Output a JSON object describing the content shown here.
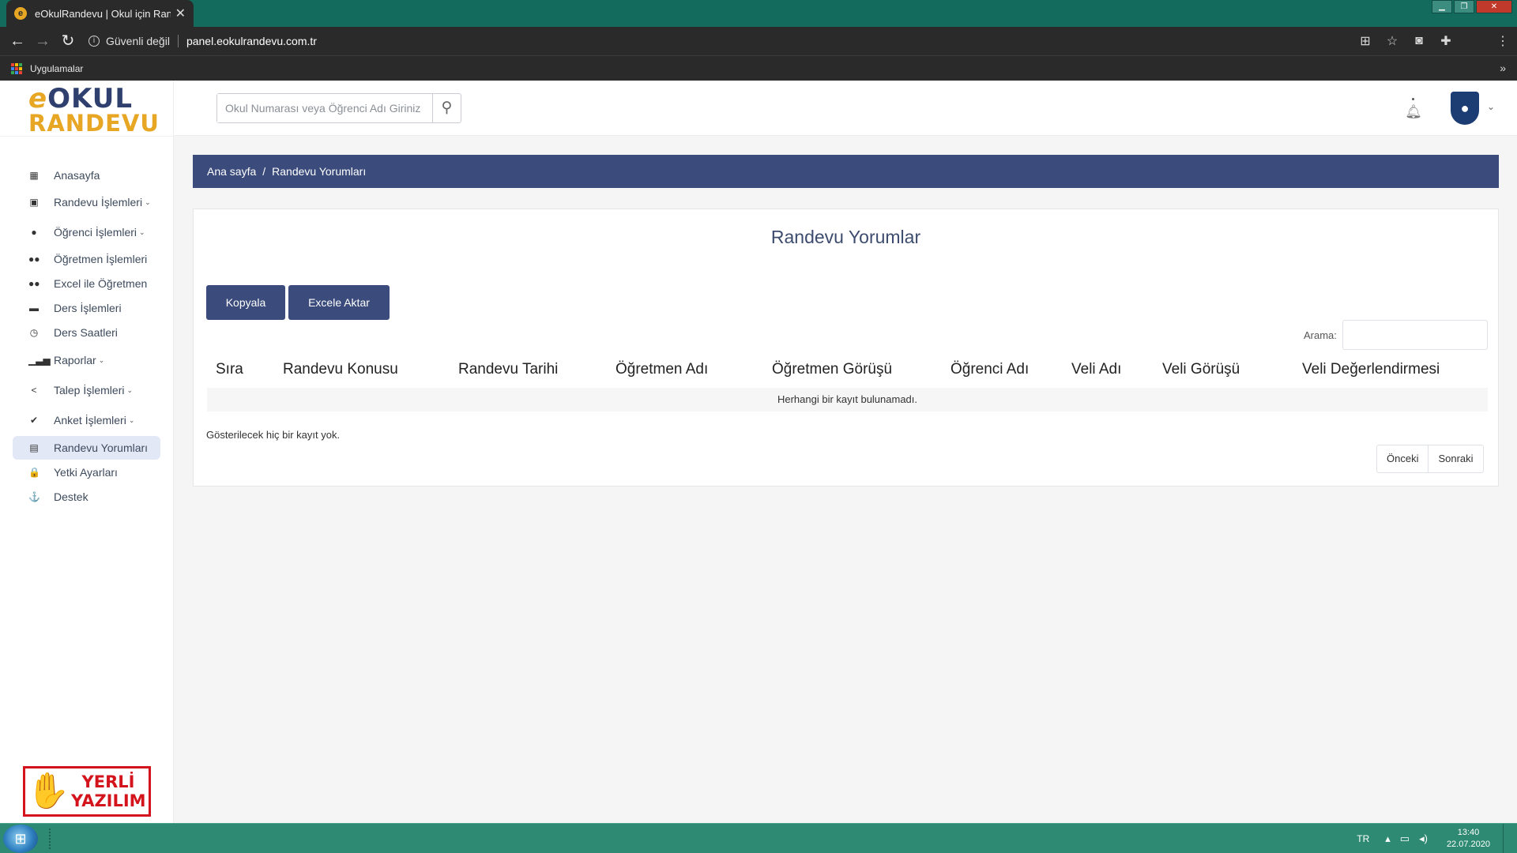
{
  "browser": {
    "tab_title": "eOkulRandevu | Okul için Randev",
    "tab_favicon": "e",
    "security_label": "Güvenli değil",
    "url": "panel.eokulrandevu.com.tr",
    "bookmarks_apps_label": "Uygulamalar",
    "bookmarks_more": "»"
  },
  "logo": {
    "line1_e": "e",
    "line1_rest": "OKUL",
    "line2": "RANDEVU"
  },
  "header": {
    "search_placeholder": "Okul Numarası veya Öğrenci Adı Giriniz"
  },
  "sidebar": {
    "items": [
      {
        "label": "Anasayfa",
        "icon": "dashboard-icon",
        "glyph": "▦",
        "caret": ""
      },
      {
        "label": "Randevu İşlemleri",
        "icon": "calendar-icon",
        "glyph": "▣",
        "caret": "⌄"
      },
      {
        "label": "Öğrenci İşlemleri",
        "icon": "user-icon",
        "glyph": "●",
        "caret": "⌄"
      },
      {
        "label": "Öğretmen İşlemleri",
        "icon": "users-icon",
        "glyph": "●●",
        "caret": ""
      },
      {
        "label": "Excel ile Öğretmen",
        "icon": "users-icon",
        "glyph": "●●",
        "caret": ""
      },
      {
        "label": "Ders İşlemleri",
        "icon": "folder-icon",
        "glyph": "▬",
        "caret": ""
      },
      {
        "label": "Ders Saatleri",
        "icon": "clock-icon",
        "glyph": "◷",
        "caret": ""
      },
      {
        "label": "Raporlar",
        "icon": "bar-chart-icon",
        "glyph": "▁▃▅",
        "caret": "⌄"
      },
      {
        "label": "Talep İşlemleri",
        "icon": "share-icon",
        "glyph": "<",
        "caret": "⌄"
      },
      {
        "label": "Anket İşlemleri",
        "icon": "check-circle-icon",
        "glyph": "✔",
        "caret": "⌄"
      },
      {
        "label": "Randevu Yorumları",
        "icon": "comment-icon",
        "glyph": "▤",
        "caret": ""
      },
      {
        "label": "Yetki Ayarları",
        "icon": "lock-icon",
        "glyph": "🔒",
        "caret": ""
      },
      {
        "label": "Destek",
        "icon": "support-icon",
        "glyph": "⚓",
        "caret": ""
      }
    ],
    "badge": {
      "line1": "YERLİ",
      "line2": "YAZILIM"
    }
  },
  "breadcrumb": {
    "home": "Ana sayfa",
    "separator": "/",
    "current": "Randevu Yorumları"
  },
  "card": {
    "title": "Randevu Yorumlar",
    "copy_button": "Kopyala",
    "export_button": "Excele Aktar",
    "search_label": "Arama:",
    "columns": [
      "Sıra",
      "Randevu Konusu",
      "Randevu Tarihi",
      "Öğretmen Adı",
      "Öğretmen Görüşü",
      "Öğrenci Adı",
      "Veli Adı",
      "Veli Görüşü",
      "Veli Değerlendirmesi"
    ],
    "empty_message": "Herhangi bir kayıt bulunamadı.",
    "info": "Gösterilecek hiç bir kayıt yok.",
    "prev": "Önceki",
    "next": "Sonraki"
  },
  "taskbar": {
    "language": "TR",
    "time": "13:40",
    "date": "22.07.2020"
  },
  "colors": {
    "primary": "#3a4b7c",
    "accent": "#e7a623",
    "taskbar": "#2e8a72",
    "brand_red": "#d3141c"
  }
}
